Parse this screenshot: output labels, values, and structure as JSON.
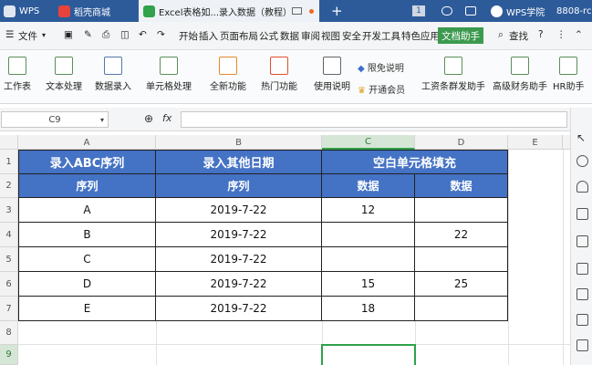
{
  "tabs": [
    {
      "label": "WPS",
      "icon": "wps-logo-icon",
      "color": "#2d5b9a"
    },
    {
      "label": "稻壳商城",
      "icon": "docer-icon",
      "color": "#e8433a"
    },
    {
      "label": "Excel表格如...录入数据（教程）",
      "icon": "sheet-icon",
      "color": "#2fa24b"
    },
    {
      "label": "WPS学院",
      "icon": "wps-academy-icon",
      "color": "#fff"
    },
    {
      "label": "8808-rc",
      "icon": "",
      "color": "#fff"
    }
  ],
  "tabbar": {
    "badge": "1",
    "add": "+"
  },
  "menu": {
    "file": "文件",
    "items": [
      "开始",
      "插入",
      "页面布局",
      "公式",
      "数据",
      "审阅",
      "视图",
      "安全",
      "开发工具",
      "特色应用"
    ],
    "active": "文档助手",
    "search": "查找"
  },
  "ribbon": {
    "buttons": [
      "工作表",
      "文本处理",
      "数据录入",
      "单元格处理",
      "全新功能",
      "热门功能",
      "使用说明",
      "工资条群发助手",
      "高级财务助手",
      "HR助手"
    ],
    "small": [
      "限免说明",
      "开通会员"
    ]
  },
  "formula": {
    "cell_ref": "C9",
    "fx": "fx",
    "value": ""
  },
  "columns": [
    "A",
    "B",
    "C",
    "D",
    "E"
  ],
  "rows": [
    "1",
    "2",
    "3",
    "4",
    "5",
    "6",
    "7",
    "8",
    "9"
  ],
  "table": {
    "header1": [
      "录入ABC序列",
      "录入其他日期",
      "空白单元格填充"
    ],
    "header2": [
      "序列",
      "序列",
      "数据",
      "数据"
    ],
    "body": [
      [
        "A",
        "2019-7-22",
        "12",
        ""
      ],
      [
        "B",
        "2019-7-22",
        "",
        "22"
      ],
      [
        "C",
        "2019-7-22",
        "",
        ""
      ],
      [
        "D",
        "2019-7-22",
        "15",
        "25"
      ],
      [
        "E",
        "2019-7-22",
        "18",
        ""
      ]
    ]
  },
  "colors": {
    "header_blue": "#4472c4",
    "selection_green": "#2fa24b"
  }
}
